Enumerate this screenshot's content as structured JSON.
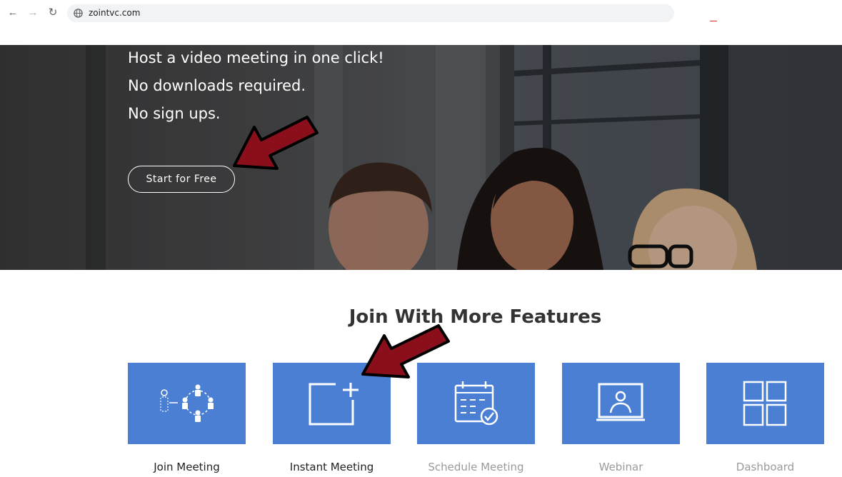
{
  "browser": {
    "url": "zointvc.com",
    "icons": {
      "back": "back-arrow-icon",
      "forward": "forward-arrow-icon",
      "reload": "reload-icon",
      "site": "globe-icon"
    }
  },
  "hero": {
    "lines": [
      "Host a video meeting in one click!",
      "No downloads required.",
      "No sign ups."
    ],
    "cta_label": "Start for Free"
  },
  "features": {
    "title": "Join With More Features",
    "tiles": [
      {
        "label": "Join Meeting",
        "icon": "people-network-icon"
      },
      {
        "label": "Instant Meeting",
        "icon": "add-square-icon"
      },
      {
        "label": "Schedule Meeting",
        "icon": "calendar-check-icon"
      },
      {
        "label": "Webinar",
        "icon": "presenter-screen-icon"
      },
      {
        "label": "Dashboard",
        "icon": "grid-icon"
      }
    ]
  },
  "colors": {
    "tile": "#4a7fd4",
    "arrow": "#8b0f1a",
    "hero_text": "#ffffff"
  }
}
